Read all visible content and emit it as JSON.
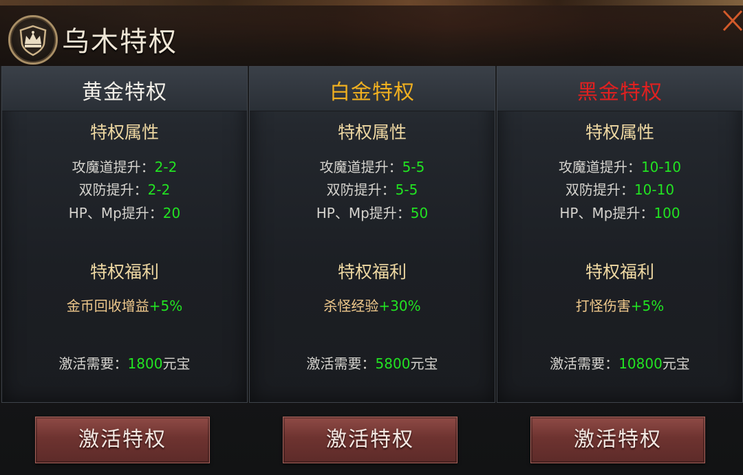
{
  "header": {
    "title": "乌木特权",
    "crown_icon": "crown-icon",
    "close_icon": "close-icon"
  },
  "colors": {
    "gold_title": "#f2efe8",
    "platinum_title": "#f0b020",
    "black_title": "#e02020",
    "section": "#efd9a3",
    "value_green": "#22e322",
    "benefit": "#f0c98c"
  },
  "cards": [
    {
      "title": "黄金特权",
      "attr_heading": "特权属性",
      "attrs": [
        {
          "label": "攻魔道提升：",
          "value": "2-2"
        },
        {
          "label": "双防提升：",
          "value": "2-2"
        },
        {
          "label": "HP、Mp提升：",
          "value": "20"
        }
      ],
      "benefit_heading": "特权福利",
      "benefit_label": "金币回收增益",
      "benefit_value": "+5%",
      "cost_label": "激活需要：",
      "cost_value": "1800",
      "cost_unit": "元宝",
      "button": "激活特权"
    },
    {
      "title": "白金特权",
      "attr_heading": "特权属性",
      "attrs": [
        {
          "label": "攻魔道提升：",
          "value": "5-5"
        },
        {
          "label": "双防提升：",
          "value": "5-5"
        },
        {
          "label": "HP、Mp提升：",
          "value": "50"
        }
      ],
      "benefit_heading": "特权福利",
      "benefit_label": "杀怪经验",
      "benefit_value": "+30%",
      "cost_label": "激活需要：",
      "cost_value": "5800",
      "cost_unit": "元宝",
      "button": "激活特权"
    },
    {
      "title": "黑金特权",
      "attr_heading": "特权属性",
      "attrs": [
        {
          "label": "攻魔道提升：",
          "value": "10-10"
        },
        {
          "label": "双防提升：",
          "value": "10-10"
        },
        {
          "label": "HP、Mp提升：",
          "value": "100"
        }
      ],
      "benefit_heading": "特权福利",
      "benefit_label": "打怪伤害",
      "benefit_value": "+5%",
      "cost_label": "激活需要：",
      "cost_value": "10800",
      "cost_unit": "元宝",
      "button": "激活特权"
    }
  ]
}
